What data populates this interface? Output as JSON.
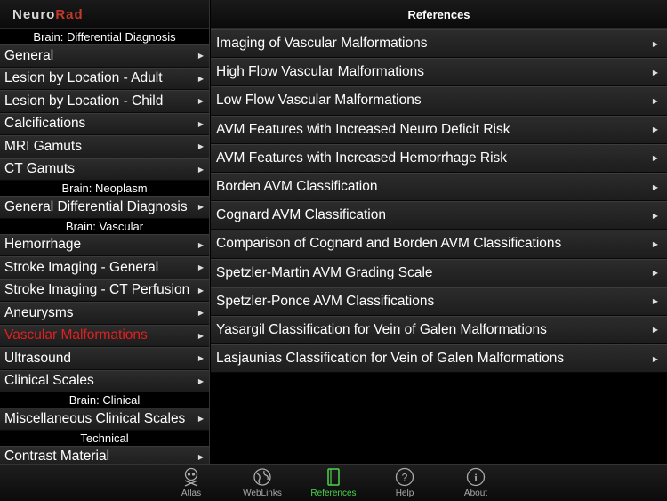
{
  "app": {
    "logo_part1": "Neuro",
    "logo_part2": "Rad"
  },
  "sidebar": {
    "sections": [
      {
        "header": "Brain: Differential Diagnosis",
        "items": [
          "General",
          "Lesion by Location - Adult",
          "Lesion by Location - Child",
          "Calcifications",
          "MRI Gamuts",
          "CT Gamuts"
        ]
      },
      {
        "header": "Brain: Neoplasm",
        "items": [
          "General Differential Diagnosis"
        ]
      },
      {
        "header": "Brain: Vascular",
        "items": [
          "Hemorrhage",
          "Stroke Imaging - General",
          "Stroke Imaging - CT Perfusion",
          "Aneurysms",
          "Vascular Malformations",
          "Ultrasound",
          "Clinical Scales"
        ]
      },
      {
        "header": "Brain: Clinical",
        "items": [
          "Miscellaneous Clinical Scales"
        ]
      },
      {
        "header": "Technical",
        "items": [
          "Contrast Material"
        ]
      }
    ],
    "active_item": "Vascular Malformations"
  },
  "main": {
    "title": "References",
    "items": [
      "Imaging of Vascular Malformations",
      "High Flow Vascular Malformations",
      "Low Flow Vascular Malformations",
      "AVM Features with Increased Neuro Deficit Risk",
      "AVM Features with Increased Hemorrhage Risk",
      "Borden AVM Classification",
      "Cognard AVM Classification",
      "Comparison of Cognard and Borden AVM Classifications",
      "Spetzler-Martin AVM Grading Scale",
      "Spetzler-Ponce AVM Classifications",
      "Yasargil Classification for Vein of Galen Malformations",
      "Lasjaunias Classification for Vein of Galen Malformations"
    ]
  },
  "tabbar": {
    "tabs": [
      {
        "label": "Atlas",
        "icon": "skull-icon"
      },
      {
        "label": "WebLinks",
        "icon": "globe-icon"
      },
      {
        "label": "References",
        "icon": "book-icon"
      },
      {
        "label": "Help",
        "icon": "question-icon"
      },
      {
        "label": "About",
        "icon": "info-icon"
      }
    ],
    "active_tab": "References",
    "active_color": "#4cd44c"
  },
  "colors": {
    "active_item": "#e02020",
    "logo_accent": "#c0392b"
  }
}
